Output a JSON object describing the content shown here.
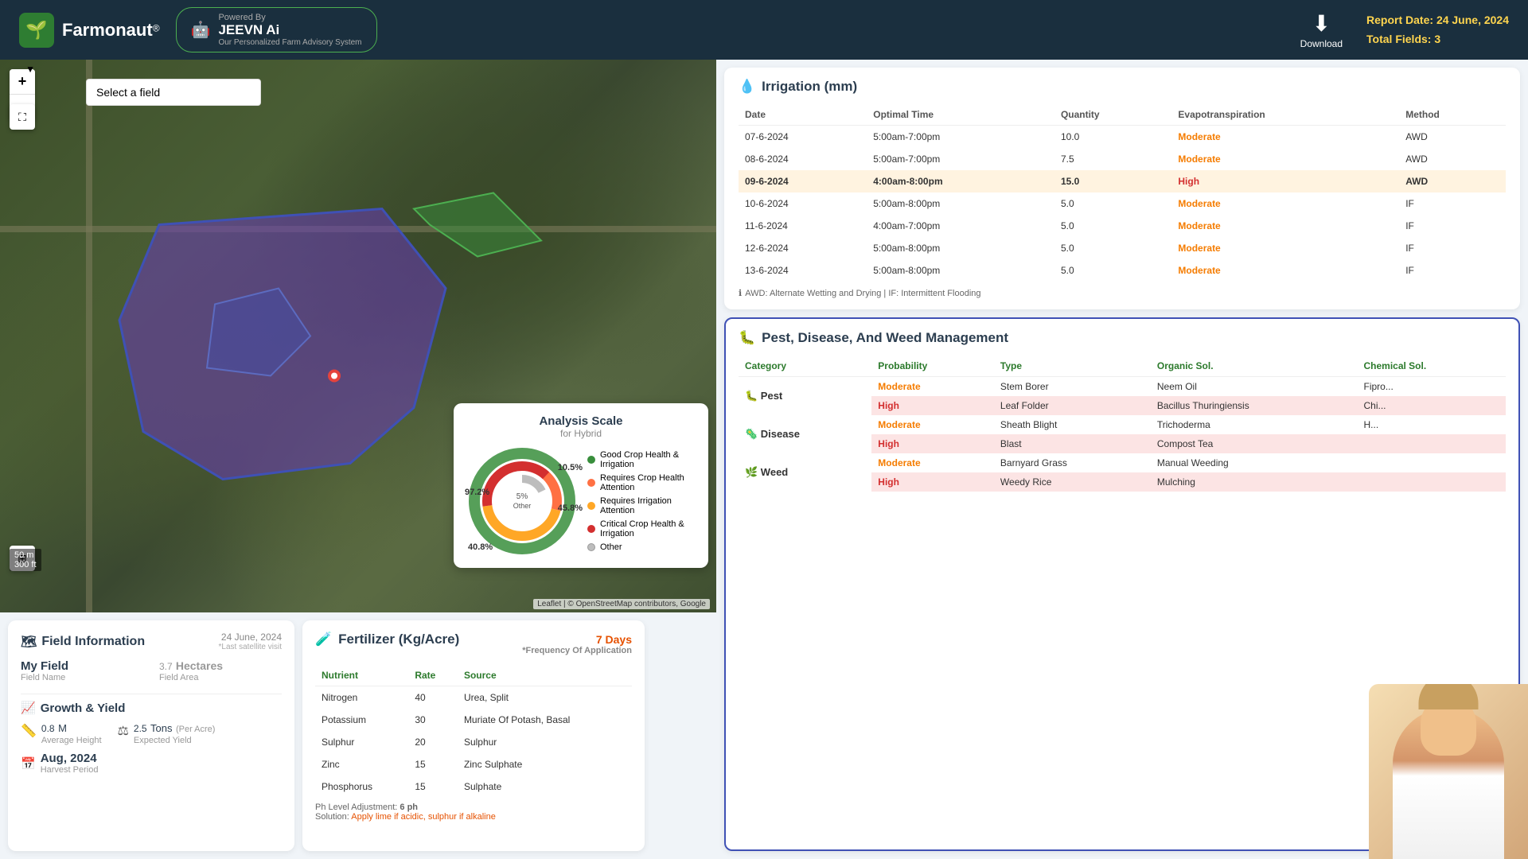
{
  "header": {
    "logo_text": "Farmonaut",
    "logo_reg": "®",
    "jeevn_name": "JEEVN Ai",
    "jeevn_powered": "Powered By",
    "jeevn_desc": "Our Personalized Farm Advisory System",
    "download_label": "Download",
    "report_date_label": "Report Date:",
    "report_date": "24 June, 2024",
    "total_fields_label": "Total Fields:",
    "total_fields": "3"
  },
  "map": {
    "select_placeholder": "Select a field",
    "zoom_in": "+",
    "zoom_out": "−",
    "scale_m": "50 m",
    "scale_ft": "300 ft",
    "attribution": "Leaflet | © OpenStreetMap contributors, Google"
  },
  "analysis_scale": {
    "title": "Analysis Scale",
    "subtitle": "for Hybrid",
    "segments": [
      {
        "label": "Good Crop Health & Irrigation",
        "value": "97.2%",
        "color": "#388e3c"
      },
      {
        "label": "Requires Crop Health Attention",
        "value": "10.5%",
        "color": "#ff7043"
      },
      {
        "label": "Requires Irrigation Attention",
        "value": "45.8%",
        "color": "#ffa726"
      },
      {
        "label": "Critical Crop Health & Irrigation",
        "value": "40.8%",
        "color": "#d32f2f"
      },
      {
        "label": "Other",
        "value": "5%",
        "color": "#bdbdbd"
      }
    ],
    "center_label": "5%\nOther"
  },
  "irrigation": {
    "title": "Irrigation (mm)",
    "title_icon": "💧",
    "columns": [
      "Date",
      "Optimal Time",
      "Quantity",
      "Evapotranspiration",
      "Method"
    ],
    "rows": [
      {
        "date": "07-6-2024",
        "time": "5:00am-7:00pm",
        "qty": "10.0",
        "evap": "Moderate",
        "method": "AWD",
        "highlight": false
      },
      {
        "date": "08-6-2024",
        "time": "5:00am-7:00pm",
        "qty": "7.5",
        "evap": "Moderate",
        "method": "AWD",
        "highlight": false
      },
      {
        "date": "09-6-2024",
        "time": "4:00am-8:00pm",
        "qty": "15.0",
        "evap": "High",
        "method": "AWD",
        "highlight": true
      },
      {
        "date": "10-6-2024",
        "time": "5:00am-8:00pm",
        "qty": "5.0",
        "evap": "Moderate",
        "method": "IF",
        "highlight": false
      },
      {
        "date": "11-6-2024",
        "time": "4:00am-7:00pm",
        "qty": "5.0",
        "evap": "Moderate",
        "method": "IF",
        "highlight": false
      },
      {
        "date": "12-6-2024",
        "time": "5:00am-8:00pm",
        "qty": "5.0",
        "evap": "Moderate",
        "method": "IF",
        "highlight": false
      },
      {
        "date": "13-6-2024",
        "time": "5:00am-8:00pm",
        "qty": "5.0",
        "evap": "Moderate",
        "method": "IF",
        "highlight": false
      }
    ],
    "note": "AWD: Alternate Wetting and Drying | IF: Intermittent Flooding"
  },
  "field_info": {
    "title": "Field Information",
    "title_icon": "🗺",
    "date": "24 June, 2024",
    "date_sub": "*Last satellite visit",
    "field_name_label": "Field Name",
    "field_name": "My Field",
    "field_area_label": "Field Area",
    "field_area": "3.7",
    "field_area_unit": "Hectares",
    "growth_title": "Growth & Yield",
    "growth_icon": "📈",
    "avg_height_val": "0.8",
    "avg_height_unit": "M",
    "avg_height_label": "Average Height",
    "expected_yield_val": "2.5",
    "expected_yield_unit": "Tons",
    "expected_yield_sub": "(Per Acre)",
    "expected_yield_label": "Expected Yield",
    "harvest_val": "Aug, 2024",
    "harvest_label": "Harvest Period"
  },
  "fertilizer": {
    "title": "Fertilizer (Kg/Acre)",
    "title_icon": "🧪",
    "freq_label": "*Frequency Of Application",
    "freq_val": "7 Days",
    "columns": [
      "Nutrient",
      "Rate",
      "Source"
    ],
    "rows": [
      {
        "nutrient": "Nitrogen",
        "rate": "40",
        "source": "Urea, Split"
      },
      {
        "nutrient": "Potassium",
        "rate": "30",
        "source": "Muriate Of Potash, Basal"
      },
      {
        "nutrient": "Sulphur",
        "rate": "20",
        "source": "Sulphur"
      },
      {
        "nutrient": "Zinc",
        "rate": "15",
        "source": "Zinc Sulphate"
      },
      {
        "nutrient": "Phosphorus",
        "rate": "15",
        "source": "Sulphate"
      }
    ],
    "ph_label": "Ph Level Adjustment:",
    "ph_val": "6 ph",
    "solution_label": "Solution:",
    "solution_text": "Apply lime if acidic, sulphur if alkaline"
  },
  "pest": {
    "title": "Pest, Disease, And Weed Management",
    "title_icon": "🐛",
    "columns": [
      "Category",
      "Probability",
      "Type",
      "Organic Sol.",
      "Chemical Sol."
    ],
    "sections": [
      {
        "category": "Pest",
        "category_icon": "🐛",
        "rows": [
          {
            "prob": "Moderate",
            "type": "Stem Borer",
            "organic": "Neem Oil",
            "chemical": "Fipro...",
            "highlight": false
          },
          {
            "prob": "High",
            "type": "Leaf Folder",
            "organic": "Bacillus Thuringiensis",
            "chemical": "Chi...",
            "highlight": true
          }
        ]
      },
      {
        "category": "Disease",
        "category_icon": "🦠",
        "rows": [
          {
            "prob": "Moderate",
            "type": "Sheath Blight",
            "organic": "Trichoderma",
            "chemical": "H...",
            "highlight": false
          },
          {
            "prob": "High",
            "type": "Blast",
            "organic": "Compost Tea",
            "chemical": "",
            "highlight": true
          }
        ]
      },
      {
        "category": "Weed",
        "category_icon": "🌿",
        "rows": [
          {
            "prob": "Moderate",
            "type": "Barnyard Grass",
            "organic": "Manual Weeding",
            "chemical": "",
            "highlight": false
          },
          {
            "prob": "High",
            "type": "Weedy Rice",
            "organic": "Mulching",
            "chemical": "",
            "highlight": true
          }
        ]
      }
    ]
  }
}
